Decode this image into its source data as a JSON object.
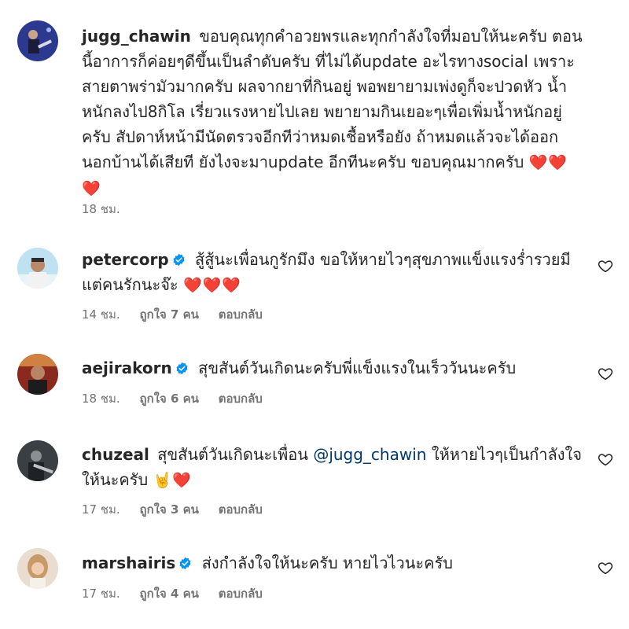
{
  "colors": {
    "text": "#262626",
    "meta": "#737373",
    "mention": "#00376b",
    "verified_badge": "#0095f6",
    "heart_emoji": "#e0245e"
  },
  "comments": [
    {
      "username": "jugg_chawin",
      "verified": false,
      "text": "ขอบคุณทุกคำอวยพรและทุกกำลังใจที่มอบให้นะครับ ตอนนี้อาการก็ค่อยๆดีขึ้นเป็นลำดับครับ ที่ไม่ได้update อะไรทางsocial เพราะสายตาพร่ามัวมากครับ ผลจากยาที่กินอยู่ พอพยายามเพ่งดูก็จะปวดหัว น้ำหนักลงไป8กิโล เรี่ยวแรงหายไปเลย พยายามกินเยอะๆเพื่อเพิ่มน้ำหนักอยู่ครับ สัปดาห์หน้ามีนัดตรวจอีกทีว่าหมดเชื้อหรือยัง ถ้าหมดแล้วจะได้ออกนอกบ้านได้เสียที ยังไงจะมาupdate อีกทีนะครับ ขอบคุณมากครับ",
      "emoji": "❤️❤️❤️",
      "time": "18 ชม.",
      "likes": "",
      "reply": ""
    },
    {
      "username": "petercorp",
      "verified": true,
      "text": "สู้สู้นะเพื่อนกูรักมึง ขอให้หายไวๆสุขภาพแข็งแรงร่ำรวยมีแต่คนรักนะจ๊ะ",
      "emoji": "❤️❤️❤️",
      "time": "14 ชม.",
      "likes": "ถูกใจ 7 คน",
      "reply": "ตอบกลับ"
    },
    {
      "username": "aejirakorn",
      "verified": true,
      "text": "สุขสันต์วันเกิดนะครับพี่แข็งแรงในเร็ววันนะครับ",
      "emoji": "",
      "time": "18 ชม.",
      "likes": "ถูกใจ 6 คน",
      "reply": "ตอบกลับ"
    },
    {
      "username": "chuzeal",
      "verified": false,
      "text_before": "สุขสันต์วันเกิดนะเพื่อน",
      "mention": "@jugg_chawin",
      "text_after": "ให้หายไวๆเป็นกำลังใจให้นะครับ",
      "emoji": "🤘❤️",
      "time": "17 ชม.",
      "likes": "ถูกใจ 3 คน",
      "reply": "ตอบกลับ"
    },
    {
      "username": "marshairis",
      "verified": true,
      "text": "ส่งกำลังใจให้นะครับ หายไวไวนะครับ",
      "emoji": "",
      "time": "17 ชม.",
      "likes": "ถูกใจ 4 คน",
      "reply": "ตอบกลับ"
    }
  ]
}
